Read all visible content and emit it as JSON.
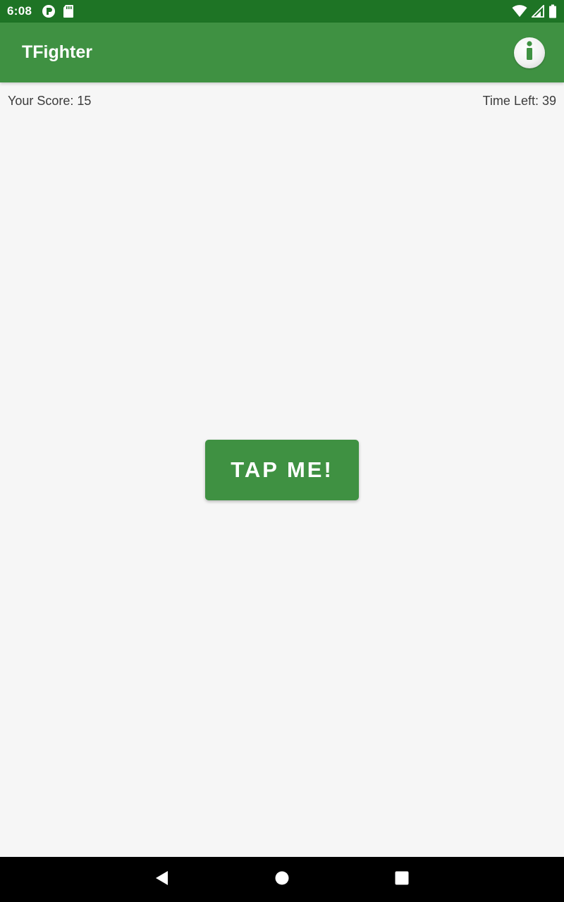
{
  "status_bar": {
    "time": "6:08",
    "left_icons": [
      "vpn-key-icon",
      "sd-card-icon"
    ],
    "right_icons": [
      "wifi-icon",
      "cell-signal-icon",
      "battery-icon"
    ]
  },
  "app_bar": {
    "title": "TFighter",
    "action_icon": "info-icon",
    "background_color": "#3f9142"
  },
  "game": {
    "score_label": "Your Score: 15",
    "time_label": "Time Left: 39",
    "tap_button_label": "TAP ME!"
  },
  "nav_bar": {
    "icons": [
      "back-icon",
      "home-icon",
      "recents-icon"
    ]
  },
  "colors": {
    "status_bar": "#1e7425",
    "primary": "#3f9142",
    "background": "#f6f6f6",
    "text": "#3c3c3c"
  }
}
